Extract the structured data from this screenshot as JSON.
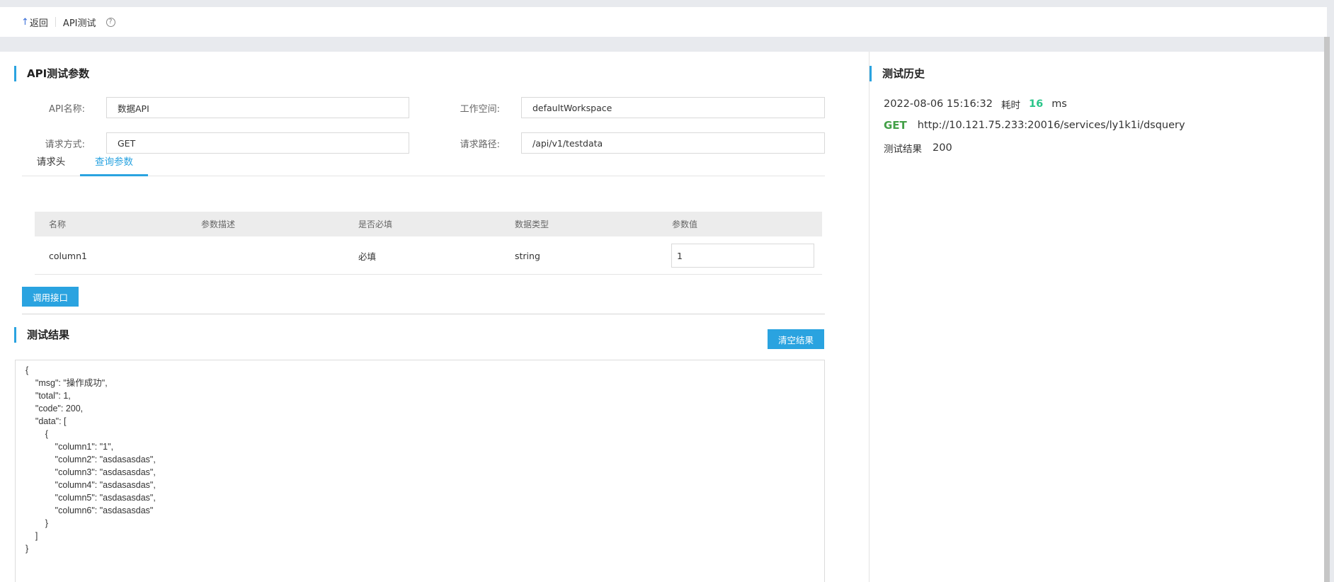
{
  "header": {
    "back_label": "返回",
    "page_title": "API测试",
    "help_icon": "?"
  },
  "params_section": {
    "title": "API测试参数",
    "api_name_label": "API名称:",
    "api_name_value": "数据API",
    "workspace_label": "工作空间:",
    "workspace_value": "defaultWorkspace",
    "method_label": "请求方式:",
    "method_value": "GET",
    "path_label": "请求路径:",
    "path_value": "/api/v1/testdata"
  },
  "tabs": [
    {
      "label": "请求头",
      "active": false
    },
    {
      "label": "查询参数",
      "active": true
    }
  ],
  "param_table": {
    "columns": [
      "名称",
      "参数描述",
      "是否必填",
      "数据类型",
      "参数值"
    ],
    "rows": [
      {
        "name": "column1",
        "description": "",
        "required": "必填",
        "type": "string",
        "value": "1"
      }
    ]
  },
  "invoke_button": "调用接口",
  "result_section": {
    "title": "测试结果",
    "clear_button": "清空结果",
    "body": "{\n    \"msg\": \"操作成功\",\n    \"total\": 1,\n    \"code\": 200,\n    \"data\": [\n        {\n            \"column1\": \"1\",\n            \"column2\": \"asdasasdas\",\n            \"column3\": \"asdasasdas\",\n            \"column4\": \"asdasasdas\",\n            \"column5\": \"asdasasdas\",\n            \"column6\": \"asdasasdas\"\n        }\n    ]\n}"
  },
  "history": {
    "title": "测试历史",
    "items": [
      {
        "time": "2022-08-06 15:16:32",
        "elapsed_label": "耗时",
        "elapsed_value": "16",
        "elapsed_unit": "ms",
        "method": "GET",
        "url": "http://10.121.75.233:20016/services/ly1k1i/dsquery",
        "result_label": "测试结果",
        "result_value": "200"
      }
    ]
  },
  "colors": {
    "accent": "#2aa3e0",
    "method_get": "#43a047",
    "elapsed_value": "#2bc58a"
  }
}
